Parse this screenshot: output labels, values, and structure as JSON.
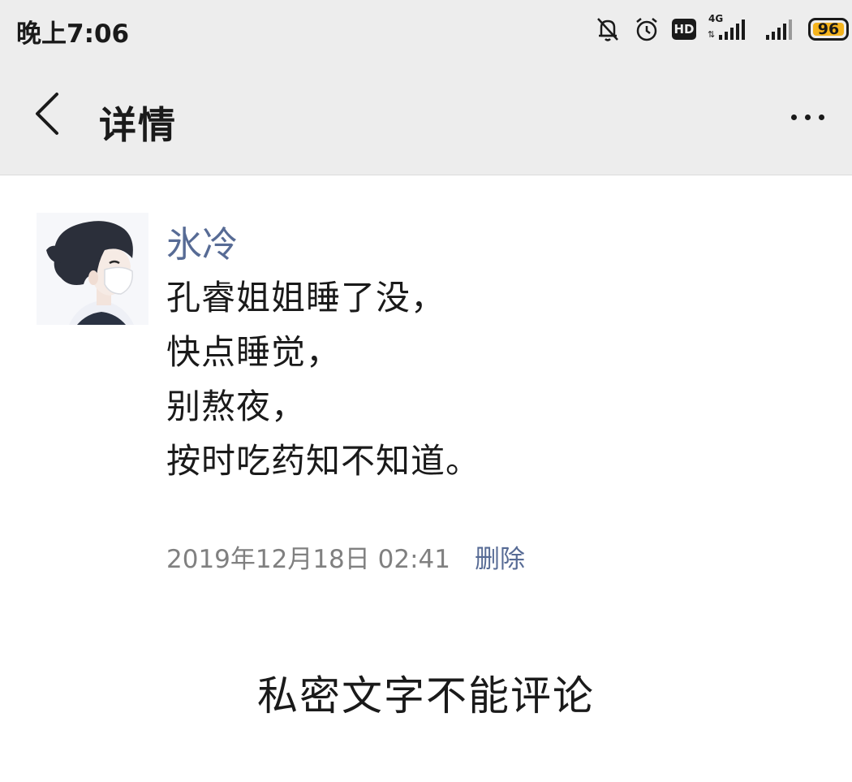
{
  "status_bar": {
    "time": "晚上7:06",
    "icons": [
      "bell-muted-icon",
      "alarm-icon",
      "hd-icon",
      "signal-4g-icon",
      "signal-icon",
      "battery-icon"
    ],
    "hd_label": "HD",
    "network_label": "4G",
    "battery_level": "96",
    "battery_color": "#f5b41e"
  },
  "header": {
    "title": "详情",
    "back_icon": "chevron-left-icon",
    "more_icon": "more-horizontal-icon"
  },
  "post": {
    "author": "氷冷",
    "lines": [
      "孔睿姐姐睡了没，",
      "快点睡觉，",
      "别熬夜，",
      "按时吃药知不知道。"
    ],
    "timestamp": "2019年12月18日 02:41",
    "delete_label": "删除"
  },
  "footer_note": "私密文字不能评论",
  "colors": {
    "link": "#576b95",
    "header_bg": "#ededed",
    "text": "#1a1a1a",
    "meta": "#808080"
  }
}
